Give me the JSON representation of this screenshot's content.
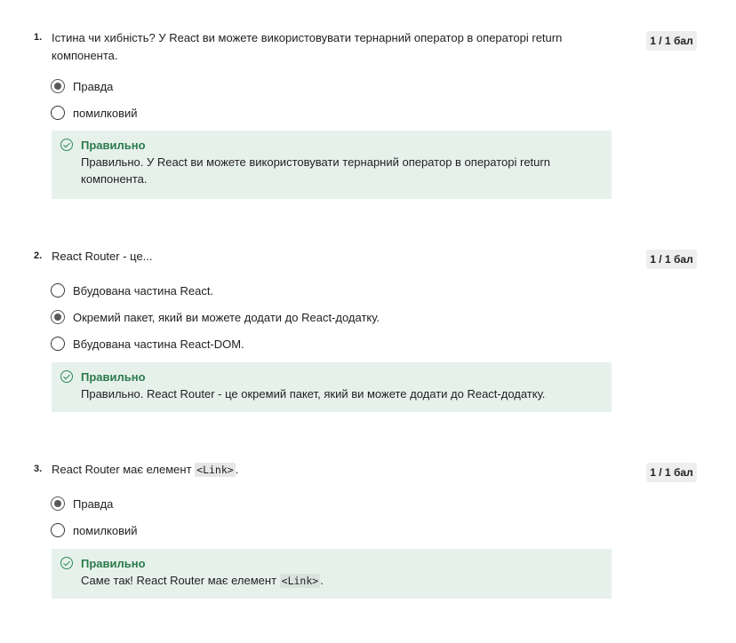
{
  "questions": [
    {
      "number": "1.",
      "text": "Істина чи хибність? У React ви можете використовувати тернарний оператор в операторі return компонента.",
      "score": "1 / 1 бал",
      "options": [
        {
          "label": "Правда",
          "selected": true
        },
        {
          "label": "помилковий",
          "selected": false
        }
      ],
      "feedback": {
        "title": "Правильно",
        "text": "Правильно. У React ви можете використовувати тернарний оператор в операторі return компонента."
      }
    },
    {
      "number": "2.",
      "text": "React Router - це...",
      "score": "1 / 1 бал",
      "options": [
        {
          "label": "Вбудована частина React.",
          "selected": false
        },
        {
          "label": "Окремий пакет, який ви можете додати до React-додатку.",
          "selected": true
        },
        {
          "label": "Вбудована частина React-DOM.",
          "selected": false
        }
      ],
      "feedback": {
        "title": "Правильно",
        "text": "Правильно. React Router - це окремий пакет, який ви можете додати до React-додатку."
      }
    },
    {
      "number": "3.",
      "text_before": "React Router має елемент ",
      "code": "<Link>",
      "text_after": ".",
      "score": "1 / 1 бал",
      "options": [
        {
          "label": "Правда",
          "selected": true
        },
        {
          "label": "помилковий",
          "selected": false
        }
      ],
      "feedback": {
        "title": "Правильно",
        "text_before": "Саме так! React Router має елемент ",
        "code": "<Link>",
        "text_after": "."
      }
    }
  ],
  "colors": {
    "feedback_bg": "#e7f1ec",
    "correct_green": "#2b7a4b",
    "score_bg": "#eeeeee"
  }
}
